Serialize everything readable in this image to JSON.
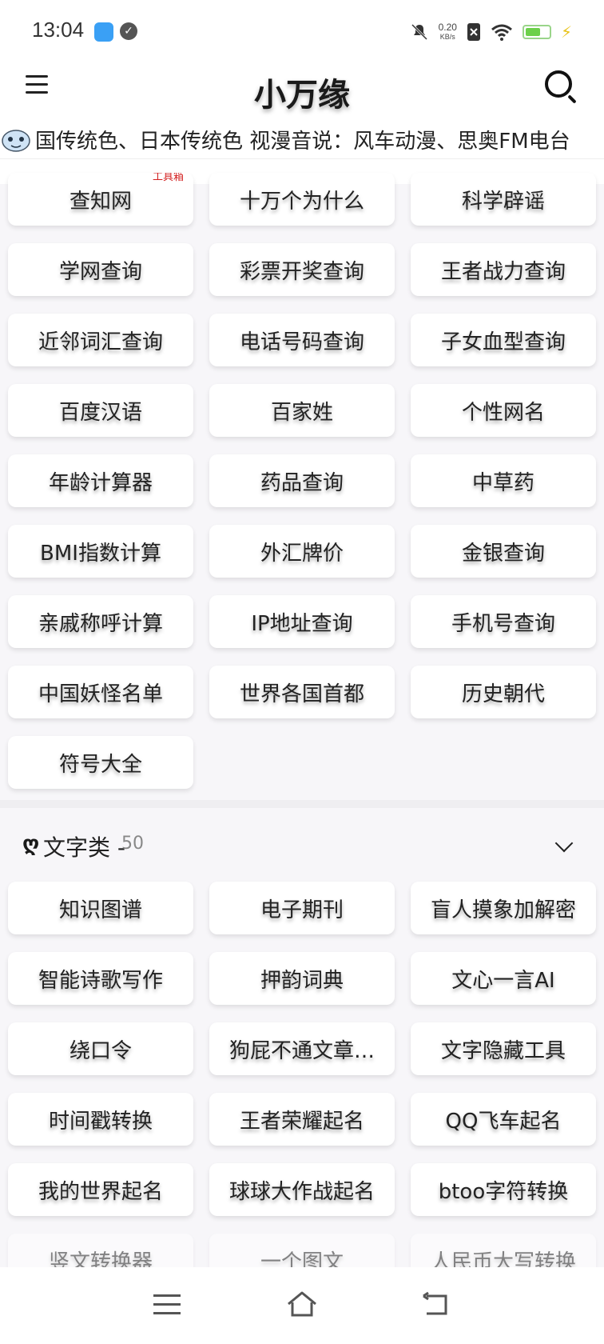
{
  "status_bar": {
    "time": "13:04",
    "net_speed_value": "0.20",
    "net_speed_unit": "KB/s",
    "icons": [
      "app-badge-icon",
      "check-circle-icon",
      "bell-muted-icon",
      "sim-x-icon",
      "wifi-icon",
      "battery-icon",
      "charging-bolt-icon"
    ]
  },
  "header": {
    "title": "小万缘",
    "ticker": "国传统色、日本传统色 视漫音说：风车动漫、思奥FM电台"
  },
  "tools_grid": {
    "badge_label": "工具箱",
    "items": [
      "查知网",
      "十万个为什么",
      "科学辟谣",
      "学网查询",
      "彩票开奖查询",
      "王者战力查询",
      "近邻词汇查询",
      "电话号码查询",
      "子女血型查询",
      "百度汉语",
      "百家姓",
      "个性网名",
      "年龄计算器",
      "药品查询",
      "中草药",
      "BMI指数计算",
      "外汇牌价",
      "金银查询",
      "亲戚称呼计算",
      "IP地址查询",
      "手机号查询",
      "中国妖怪名单",
      "世界各国首都",
      "历史朝代",
      "符号大全"
    ]
  },
  "text_section": {
    "icon": "ღ",
    "title": "文字类 -",
    "count": "50",
    "items": [
      "知识图谱",
      "电子期刊",
      "盲人摸象加解密",
      "智能诗歌写作",
      "押韵词典",
      "文心一言AI",
      "绕口令",
      "狗屁不通文章…",
      "文字隐藏工具",
      "时间戳转换",
      "王者荣耀起名",
      "QQ飞车起名",
      "我的世界起名",
      "球球大作战起名",
      "btoo字符转换",
      "竖文转换器",
      "一个图文",
      "人民币大写转换"
    ]
  },
  "nav_bar": {
    "icons": [
      "menu-icon",
      "home-icon",
      "back-icon"
    ]
  }
}
